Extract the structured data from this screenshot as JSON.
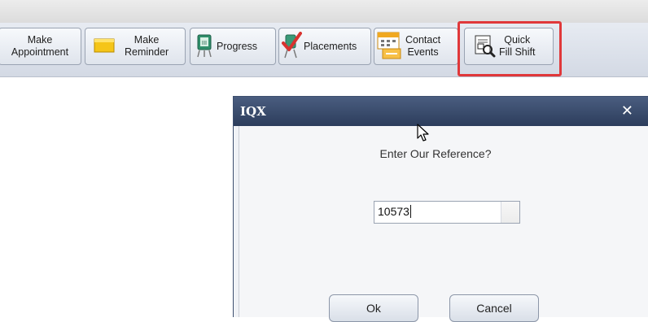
{
  "toolbar": {
    "make_appointment": {
      "line1": "Make",
      "line2": "Appointment"
    },
    "make_reminder": {
      "line1": "Make",
      "line2": "Reminder"
    },
    "progress": "Progress",
    "placements": "Placements",
    "contact_events": {
      "line1": "Contact",
      "line2": "Events"
    },
    "quick_fill_shift": {
      "line1": "Quick",
      "line2": "Fill Shift"
    }
  },
  "dialog": {
    "title": "IQX",
    "close_glyph": "✕",
    "prompt": "Enter Our Reference?",
    "reference_value": "10573",
    "ok_label": "Ok",
    "cancel_label": "Cancel"
  },
  "colors": {
    "highlight": "#e0383a",
    "dialog_title_bar": "#2c3d5c"
  },
  "icons": {
    "make_reminder": "sticky-note-icon",
    "progress": "progress-chart-icon",
    "placements": "placement-check-icon",
    "contact_events": "calendar-icon",
    "quick_fill_shift": "quick-fill-document-icon"
  }
}
